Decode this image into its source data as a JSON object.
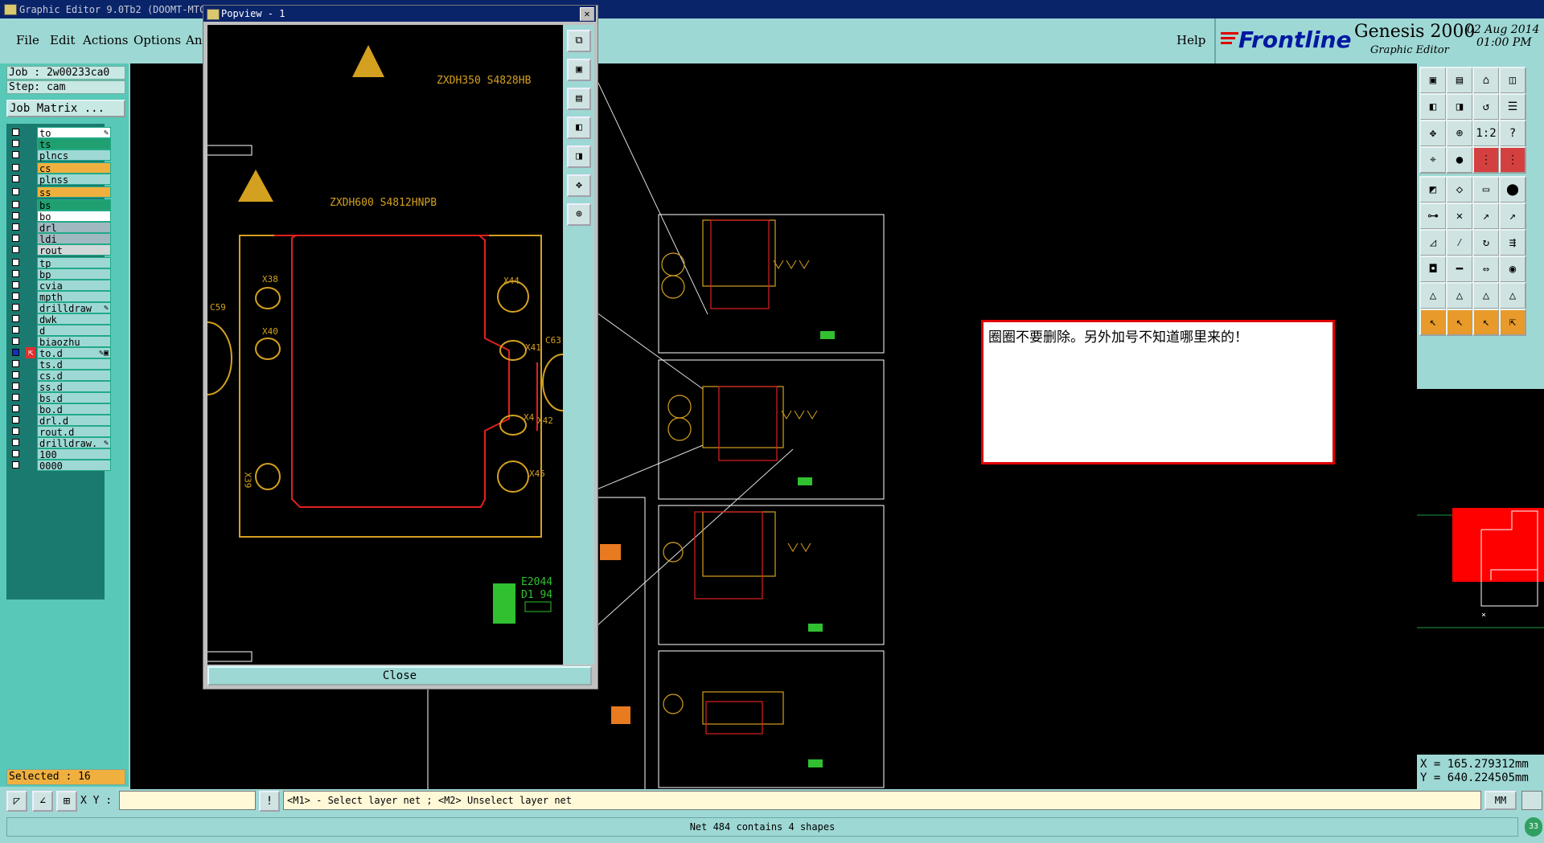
{
  "window": {
    "title": "Graphic Editor 9.0Tb2  (DOOMT-MTC)"
  },
  "menu": {
    "file": "File",
    "edit": "Edit",
    "actions": "Actions",
    "options": "Options",
    "analysis": "Ana",
    "help": "Help"
  },
  "brand": {
    "logo": "Frontline",
    "product": "Genesis 2000",
    "subtitle": "Graphic Editor",
    "date": "02 Aug 2014",
    "time": "01:00 PM"
  },
  "job": {
    "job_line": "Job : 2w00233ca0",
    "step_line": "Step: cam",
    "matrix_button": "Job Matrix ..."
  },
  "layers": [
    {
      "name": "to",
      "color": "#ffffff",
      "suffix": "✎"
    },
    {
      "name": "ts",
      "color": "#20a070"
    },
    {
      "name": "plncs",
      "color": "#9ed8d4"
    },
    {
      "name": "cs",
      "color": "#f0b040"
    },
    {
      "name": "plnss",
      "color": "#9ed8d4"
    },
    {
      "name": "ss",
      "color": "#f0b040"
    },
    {
      "name": "bs",
      "color": "#20a070"
    },
    {
      "name": "bo",
      "color": "#ffffff"
    },
    {
      "name": "drl",
      "color": "#a0b8c0"
    },
    {
      "name": "ldi",
      "color": "#a0b8c0"
    },
    {
      "name": "rout",
      "color": "#d0d8d8"
    },
    {
      "name": "tp",
      "color": "#9ed8d4"
    },
    {
      "name": "bp",
      "color": "#9ed8d4"
    },
    {
      "name": "cvia",
      "color": "#9ed8d4"
    },
    {
      "name": "mpth",
      "color": "#9ed8d4"
    },
    {
      "name": "drilldraw",
      "color": "#9ed8d4",
      "suffix": "✎"
    },
    {
      "name": "dwk",
      "color": "#9ed8d4"
    },
    {
      "name": "d",
      "color": "#9ed8d4"
    },
    {
      "name": "biaozhu",
      "color": "#9ed8d4"
    },
    {
      "name": "to.d",
      "color": "#9ed8d4",
      "suffix": "✎▣",
      "active": true
    },
    {
      "name": "ts.d",
      "color": "#9ed8d4"
    },
    {
      "name": "cs.d",
      "color": "#9ed8d4"
    },
    {
      "name": "ss.d",
      "color": "#9ed8d4"
    },
    {
      "name": "bs.d",
      "color": "#9ed8d4"
    },
    {
      "name": "bo.d",
      "color": "#9ed8d4"
    },
    {
      "name": "drl.d",
      "color": "#9ed8d4"
    },
    {
      "name": "rout.d",
      "color": "#9ed8d4"
    },
    {
      "name": "drilldraw.",
      "color": "#9ed8d4",
      "suffix": "✎"
    },
    {
      "name": "100",
      "color": "#9ed8d4"
    },
    {
      "name": "0000",
      "color": "#9ed8d4"
    }
  ],
  "selected": "Selected : 16",
  "popup": {
    "title": "Popview - 1",
    "close_label": "Close",
    "labels": {
      "part1": "ZXDH350 S4828HB",
      "part2": "ZXDH600 S4812HNPB",
      "c59": "C59",
      "c63": "C63",
      "x38": "X38",
      "x40": "X40",
      "x44": "X44",
      "x41": "X41",
      "x42": "X42",
      "x4": "X4",
      "x45": "X45",
      "x39": "X39",
      "e204": "E2044",
      "d1": "D1 94"
    }
  },
  "message": "圈圈不要删除。另外加号不知道哪里来的！",
  "coords": {
    "x": "X = 165.279312mm",
    "y": "Y = 640.224505mm"
  },
  "cmd": {
    "xy_label": "X Y :",
    "xy_value": "",
    "hint": "<M1> - Select layer net ; <M2> Unselect layer net",
    "unit": "MM",
    "badge": "33"
  },
  "status": "Net 484 contains 4 shapes",
  "colors": {
    "accent": "#9ed8d4",
    "panel": "#58c8b8",
    "title": "#0a246a",
    "board_outline": "#ffffff",
    "copper": "#d4a020",
    "trace": "#e02020",
    "silk": "#30c030"
  }
}
